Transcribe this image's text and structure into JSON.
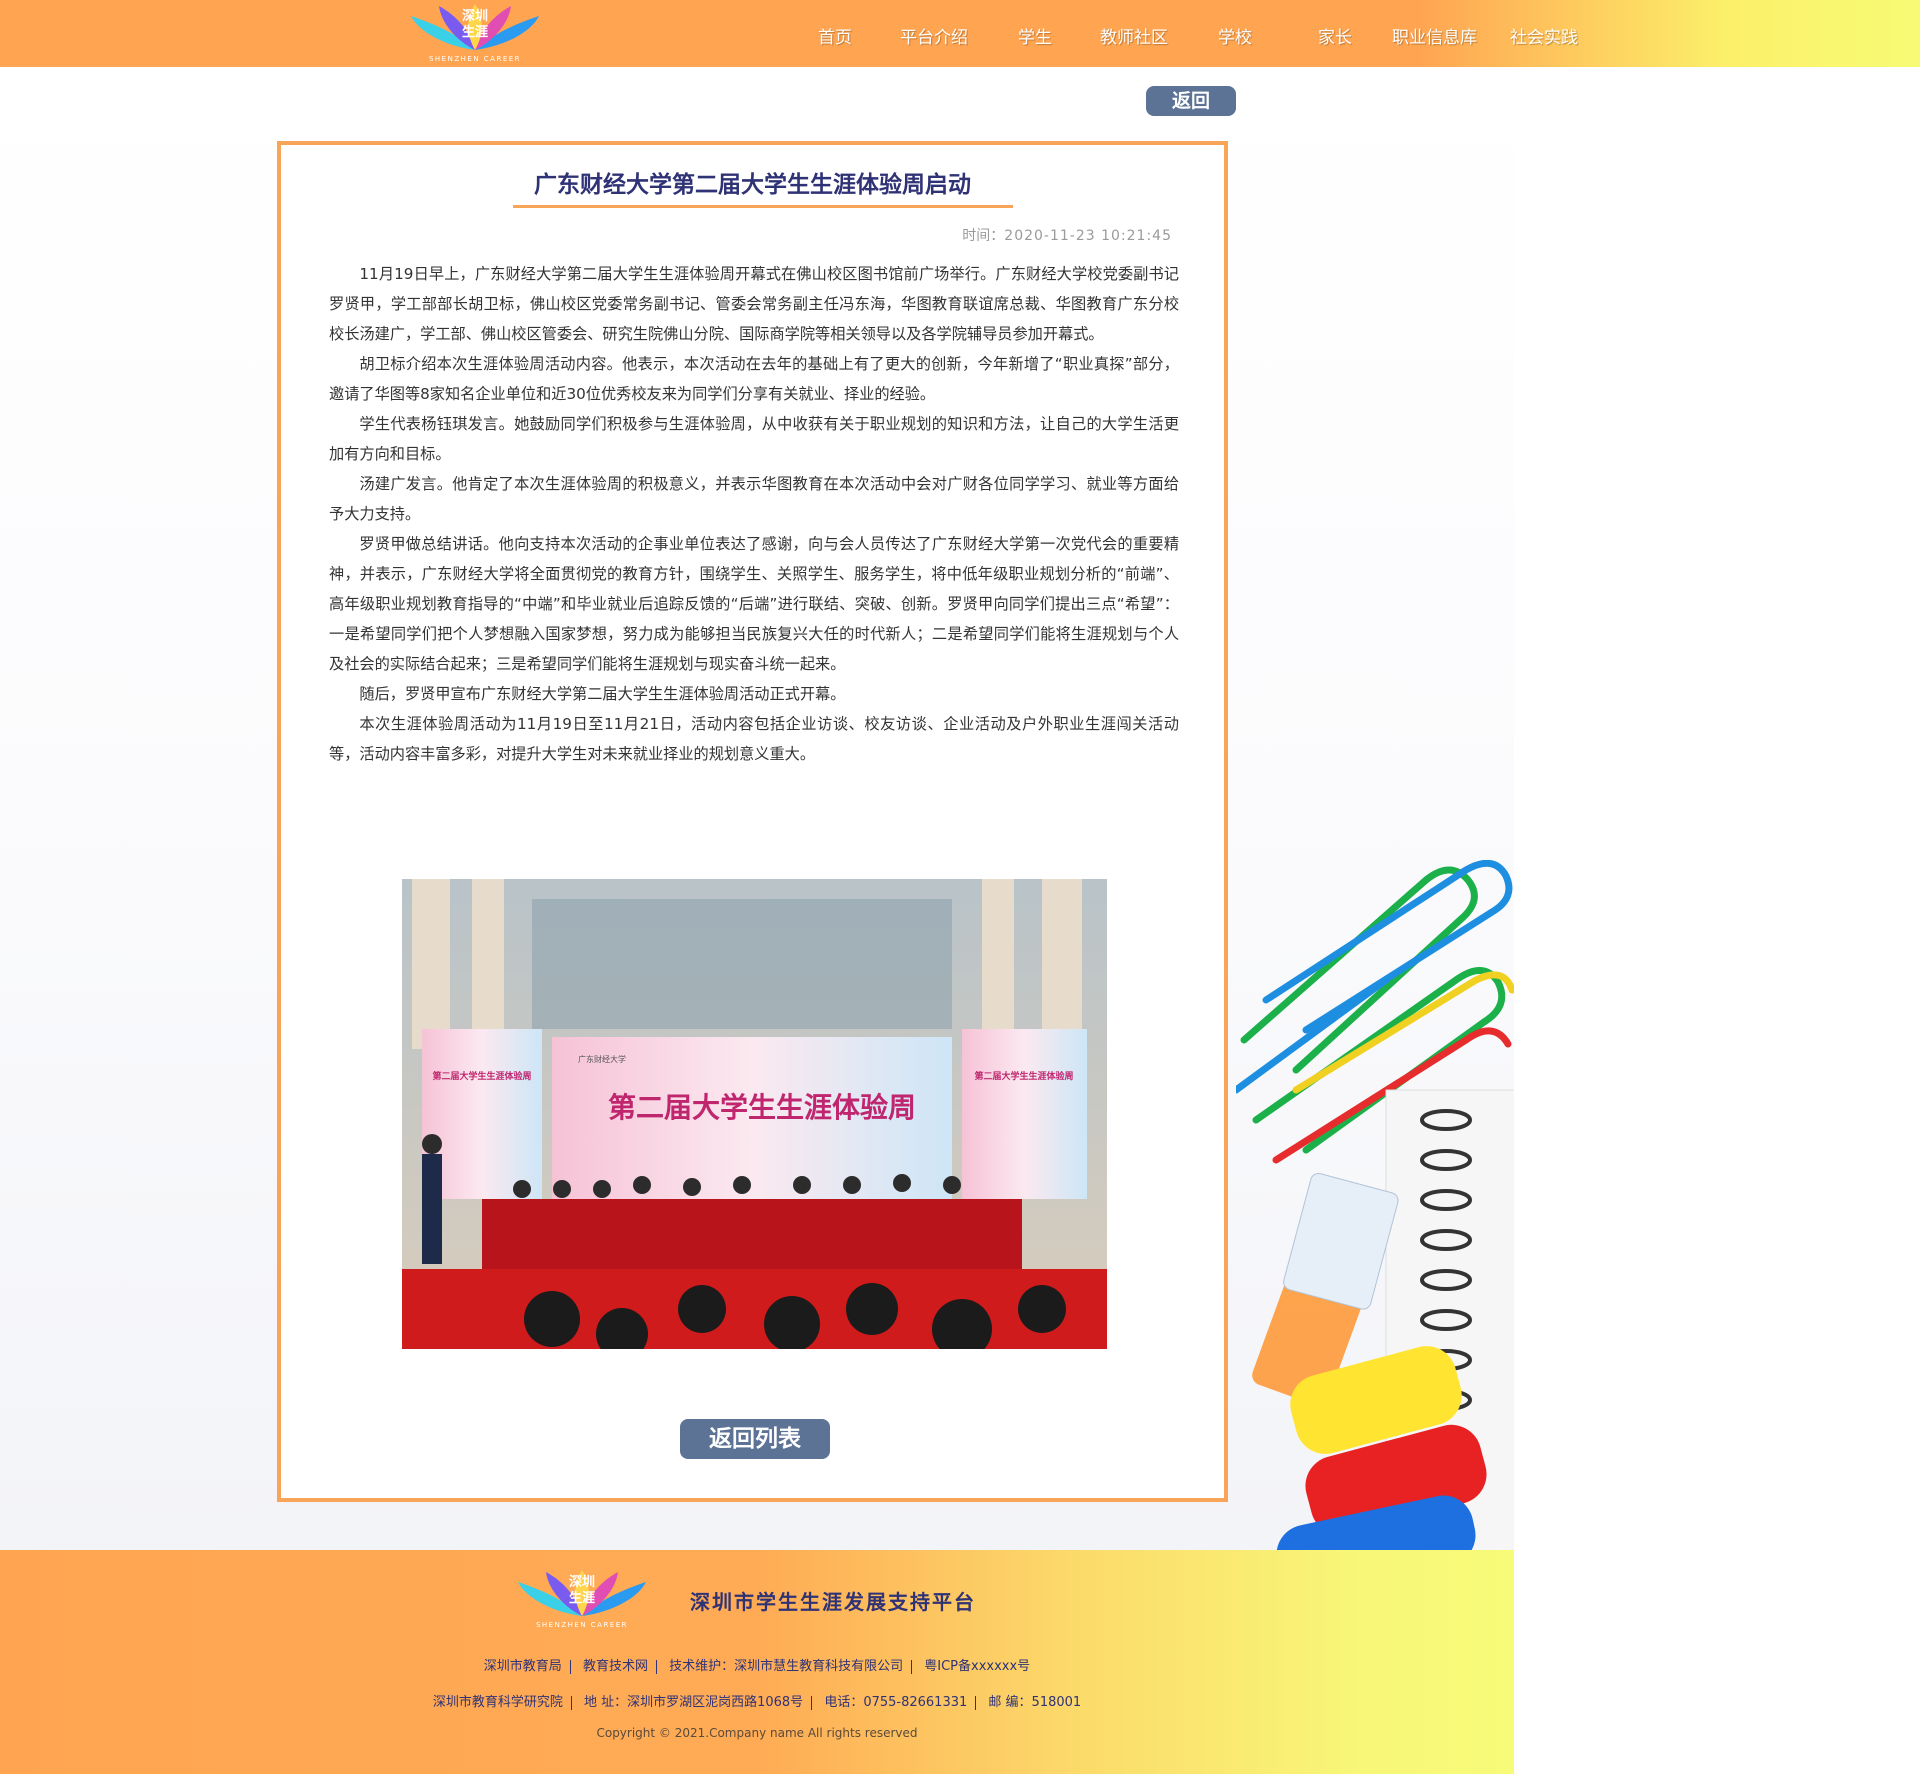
{
  "brand": {
    "logo_line1": "深圳",
    "logo_line2": "生涯",
    "logo_sub": "SHENZHEN CAREER"
  },
  "nav": {
    "items": [
      "首页",
      "平台介绍",
      "学生",
      "教师社区",
      "学校",
      "家长",
      "职业信息库",
      "社会实践"
    ]
  },
  "actions": {
    "back_label": "返回",
    "back_to_list_label": "返回列表"
  },
  "article": {
    "title": "广东财经大学第二届大学生生涯体验周启动",
    "time_label": "时间：",
    "time_value": "2020-11-23 10:21:45",
    "paragraphs": [
      "11月19日早上，广东财经大学第二届大学生生涯体验周开幕式在佛山校区图书馆前广场举行。广东财经大学校党委副书记罗贤甲，学工部部长胡卫标，佛山校区党委常务副书记、管委会常务副主任冯东海，华图教育联谊席总裁、华图教育广东分校校长汤建广，学工部、佛山校区管委会、研究生院佛山分院、国际商学院等相关领导以及各学院辅导员参加开幕式。",
      "胡卫标介绍本次生涯体验周活动内容。他表示，本次活动在去年的基础上有了更大的创新，今年新增了“职业真探”部分，邀请了华图等8家知名企业单位和近30位优秀校友来为同学们分享有关就业、择业的经验。",
      "学生代表杨钰琪发言。她鼓励同学们积极参与生涯体验周，从中收获有关于职业规划的知识和方法，让自己的大学生活更加有方向和目标。",
      "汤建广发言。他肯定了本次生涯体验周的积极意义，并表示华图教育在本次活动中会对广财各位同学学习、就业等方面给予大力支持。",
      "罗贤甲做总结讲话。他向支持本次活动的企事业单位表达了感谢，向与会人员传达了广东财经大学第一次党代会的重要精神，并表示，广东财经大学将全面贯彻党的教育方针，围绕学生、关照学生、服务学生，将中低年级职业规划分析的“前端”、高年级职业规划教育指导的“中端”和毕业就业后追踪反馈的“后端”进行联结、突破、创新。罗贤甲向同学们提出三点“希望”：一是希望同学们把个人梦想融入国家梦想，努力成为能够担当民族复兴大任的时代新人；二是希望同学们能将生涯规划与个人及社会的实际结合起来；三是希望同学们能将生涯规划与现实奋斗统一起来。",
      "随后，罗贤甲宣布广东财经大学第二届大学生生涯体验周活动正式开幕。",
      "本次生涯体验周活动为11月19日至11月21日，活动内容包括企业访谈、校友访谈、企业活动及户外职业生涯闯关活动等，活动内容丰富多彩，对提升大学生对未来就业择业的规划意义重大。"
    ],
    "photo": {
      "banner_main": "第二届大学生生涯体验周",
      "banner_left": "第二届大学生生涯体验周",
      "banner_right": "第二届大学生生涯体验周",
      "school_name": "广东财经大学"
    }
  },
  "footer": {
    "platform_name": "深圳市学生生涯发展支持平台",
    "row1": [
      "深圳市教育局",
      "教育技术网",
      "技术维护：深圳市慧生教育科技有限公司",
      "粤ICP备xxxxxx号"
    ],
    "row2": [
      "深圳市教育科学研究院",
      "地  址：深圳市罗湖区泥岗西路1068号",
      "电话：0755-82661331",
      "邮  编：518001"
    ],
    "copyright": "Copyright © 2021.Company name All rights reserved"
  },
  "colors": {
    "header_orange": "#ffa552",
    "header_yellow": "#f7fb74",
    "card_border": "#f8a55a",
    "title_navy": "#2f3275",
    "button_slate": "#5c7396"
  },
  "icons": [
    "logo-leaves-icon"
  ]
}
